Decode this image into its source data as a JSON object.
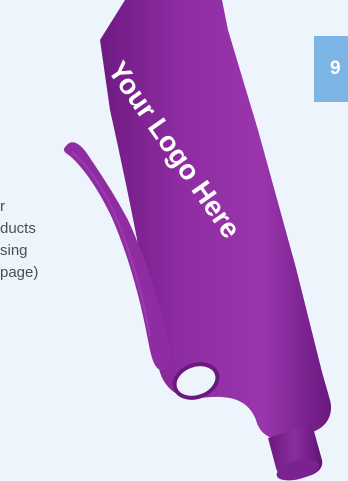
{
  "side_text": {
    "line1": "r",
    "line2": "ducts",
    "line3": "sing",
    "line4": "page)"
  },
  "badge": {
    "label": "9",
    "color": "#7cb4e6"
  },
  "pen": {
    "imprint_text": "Your Logo Here",
    "color": "#8a2a9c",
    "icon": "pen-icon"
  }
}
